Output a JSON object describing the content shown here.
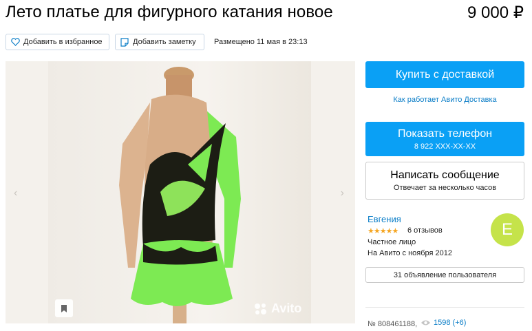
{
  "listing": {
    "title": "Лето платье для фигурного катания новое",
    "price": "9 000 ₽",
    "posted": "Размещено 11 мая в 23:13",
    "item_number": "№ 808461188,",
    "views": "1598 (+6)"
  },
  "actions": {
    "favorite_label": "Добавить в избранное",
    "note_label": "Добавить заметку"
  },
  "gallery": {
    "prev_arrow": "‹",
    "next_arrow": "›",
    "watermark": "Avito",
    "icons": [
      "chevron-left-icon",
      "chevron-right-icon",
      "bookmark-icon",
      "avito-logo-icon"
    ]
  },
  "purchase": {
    "buy_label": "Купить с доставкой",
    "delivery_link": "Как работает Авито Доставка",
    "phone_label": "Показать телефон",
    "phone_number": "8 922 XXX-XX-XX",
    "message_label": "Написать сообщение",
    "message_sub": "Отвечает за несколько часов"
  },
  "seller": {
    "name": "Евгения",
    "stars": "★★★★★",
    "rating": 5,
    "reviews": "6 отзывов",
    "type": "Частное лицо",
    "since": "На Авито с ноября 2012",
    "avatar_letter": "E",
    "listings_label": "31 объявление пользователя"
  },
  "colors": {
    "accent": "#0aa0f5",
    "link": "#0a7dc7",
    "avatar": "#c5e34a",
    "star": "#f5a623",
    "dress_green": "#7dea53"
  }
}
